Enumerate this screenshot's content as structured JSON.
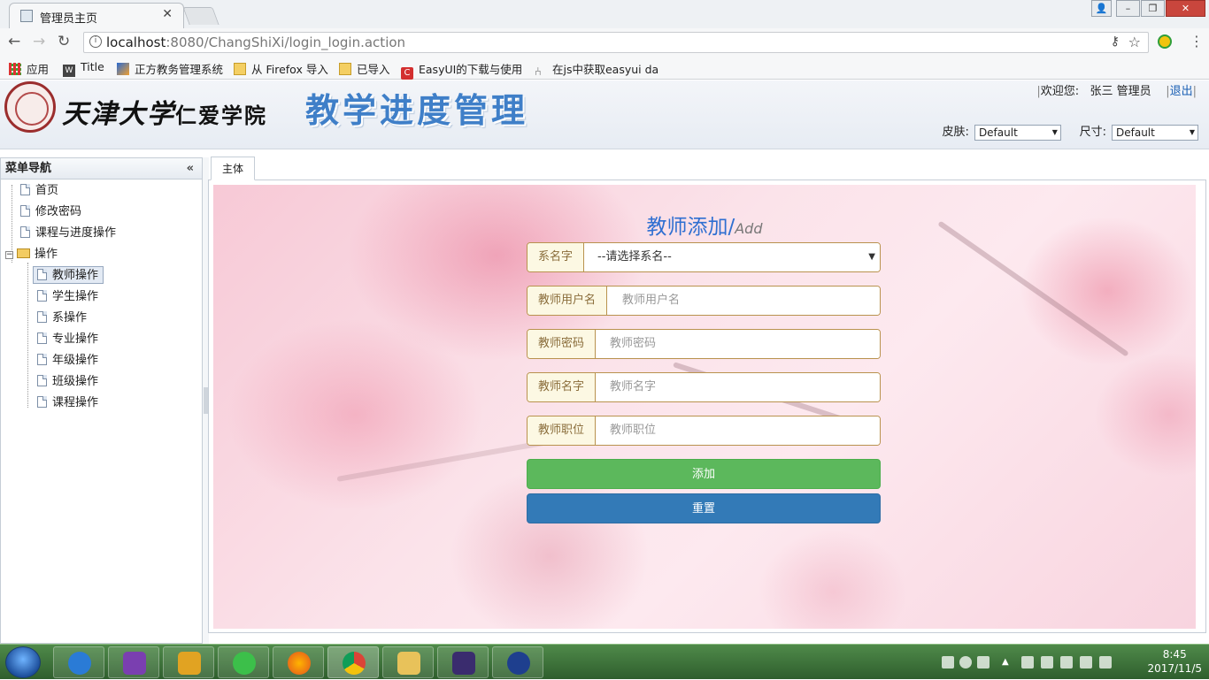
{
  "browser": {
    "tab_title": "管理员主页",
    "url_host": "localhost",
    "url_rest": ":8080/ChangShiXi/login_login.action",
    "bookmarks": [
      {
        "label": "应用"
      },
      {
        "label": "Title"
      },
      {
        "label": "正方教务管理系统"
      },
      {
        "label": "从 Firefox 导入"
      },
      {
        "label": "已导入"
      },
      {
        "label": "EasyUI的下载与使用"
      },
      {
        "label": "在js中获取easyui da"
      }
    ]
  },
  "header": {
    "university": "天津大学",
    "college": "仁爱学院",
    "system_title": "教学进度管理",
    "welcome": "欢迎您:",
    "user_name": "张三",
    "role": "管理员",
    "logout": "退出",
    "skin_label": "皮肤:",
    "skin_value": "Default",
    "size_label": "尺寸:",
    "size_value": "Default"
  },
  "nav": {
    "title": "菜单导航",
    "items": [
      {
        "label": "首页"
      },
      {
        "label": "修改密码"
      },
      {
        "label": "课程与进度操作"
      }
    ],
    "group_label": "操作",
    "sub_items": [
      {
        "label": "教师操作",
        "selected": true
      },
      {
        "label": "学生操作"
      },
      {
        "label": "系操作"
      },
      {
        "label": "专业操作"
      },
      {
        "label": "年级操作"
      },
      {
        "label": "班级操作"
      },
      {
        "label": "课程操作"
      }
    ]
  },
  "main": {
    "tab_label": "主体",
    "form": {
      "title": "教师添加/",
      "title_en": "Add",
      "dept_label": "系名字",
      "dept_value": "--请选择系名--",
      "username_label": "教师用户名",
      "username_placeholder": "教师用户名",
      "password_label": "教师密码",
      "password_placeholder": "教师密码",
      "name_label": "教师名字",
      "name_placeholder": "教师名字",
      "position_label": "教师职位",
      "position_placeholder": "教师职位",
      "add_button": "添加",
      "reset_button": "重置"
    }
  },
  "taskbar": {
    "time": "8:45",
    "date": "2017/11/5"
  },
  "colors": {
    "add_button": "#5cb85c",
    "reset_button": "#337ab7",
    "title_blue": "#2f6fd1",
    "addon_bg": "#fcf8e3",
    "addon_text": "#8a6d3b"
  }
}
